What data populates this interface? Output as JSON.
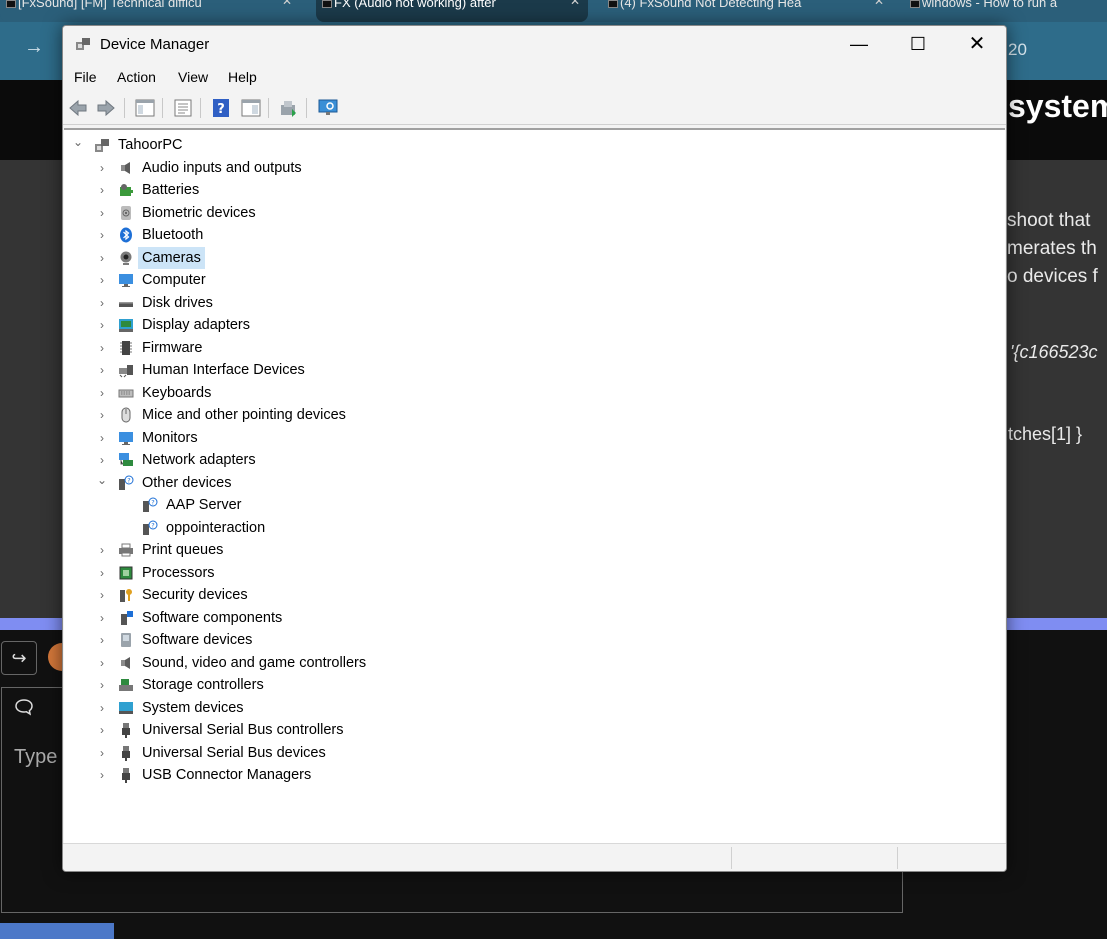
{
  "browser": {
    "tabs": [
      "[FxSound] [FM] Technical difficu",
      "FX (Audio not working) after",
      "(4) FxSound Not Detecting Hea",
      "windows - How to run a"
    ],
    "address_fragment": "20",
    "page_title_fragment": "system",
    "page_text_lines": [
      "shoot that",
      "merates th",
      "o devices f"
    ],
    "guid_fragment": "'{c166523c",
    "matches_fragment": "tches[1] }",
    "comment_placeholder": "Type"
  },
  "window": {
    "title": "Device Manager",
    "caption_buttons": {
      "minimize": "—",
      "maximize": "☐",
      "close": "✕"
    }
  },
  "menu": [
    "File",
    "Action",
    "View",
    "Help"
  ],
  "toolbar": {
    "buttons": [
      "back-arrow-icon",
      "forward-arrow-icon",
      "show-hide-console-tree-icon",
      "properties-icon",
      "help-icon",
      "action-pane-icon",
      "update-driver-icon",
      "scan-hardware-icon"
    ]
  },
  "tree": {
    "root": {
      "label": "TahoorPC",
      "icon": "computer-root-icon",
      "expanded": true
    },
    "categories": [
      {
        "label": "Audio inputs and outputs",
        "icon": "speaker-icon"
      },
      {
        "label": "Batteries",
        "icon": "battery-icon"
      },
      {
        "label": "Biometric devices",
        "icon": "fingerprint-icon"
      },
      {
        "label": "Bluetooth",
        "icon": "bluetooth-icon"
      },
      {
        "label": "Cameras",
        "icon": "camera-icon",
        "selected": true
      },
      {
        "label": "Computer",
        "icon": "monitor-icon"
      },
      {
        "label": "Disk drives",
        "icon": "disk-drive-icon"
      },
      {
        "label": "Display adapters",
        "icon": "display-adapter-icon"
      },
      {
        "label": "Firmware",
        "icon": "firmware-icon"
      },
      {
        "label": "Human Interface Devices",
        "icon": "hid-icon"
      },
      {
        "label": "Keyboards",
        "icon": "keyboard-icon"
      },
      {
        "label": "Mice and other pointing devices",
        "icon": "mouse-icon"
      },
      {
        "label": "Monitors",
        "icon": "monitor-icon"
      },
      {
        "label": "Network adapters",
        "icon": "network-icon"
      },
      {
        "label": "Other devices",
        "icon": "unknown-device-icon",
        "expanded": true,
        "children": [
          {
            "label": "AAP Server",
            "icon": "unknown-device-icon"
          },
          {
            "label": "oppointeraction",
            "icon": "unknown-device-icon"
          }
        ]
      },
      {
        "label": "Print queues",
        "icon": "printer-icon"
      },
      {
        "label": "Processors",
        "icon": "processor-icon"
      },
      {
        "label": "Security devices",
        "icon": "security-key-icon"
      },
      {
        "label": "Software components",
        "icon": "software-component-icon"
      },
      {
        "label": "Software devices",
        "icon": "software-device-icon"
      },
      {
        "label": "Sound, video and game controllers",
        "icon": "speaker-icon"
      },
      {
        "label": "Storage controllers",
        "icon": "storage-controller-icon"
      },
      {
        "label": "System devices",
        "icon": "system-device-icon"
      },
      {
        "label": "Universal Serial Bus controllers",
        "icon": "usb-icon"
      },
      {
        "label": "Universal Serial Bus devices",
        "icon": "usb-icon"
      },
      {
        "label": "USB Connector Managers",
        "icon": "usb-icon"
      }
    ]
  },
  "colors": {
    "selection": "#cce4f7",
    "tab_bar": "#2b5f7a",
    "page_accent": "#7f8df2"
  }
}
